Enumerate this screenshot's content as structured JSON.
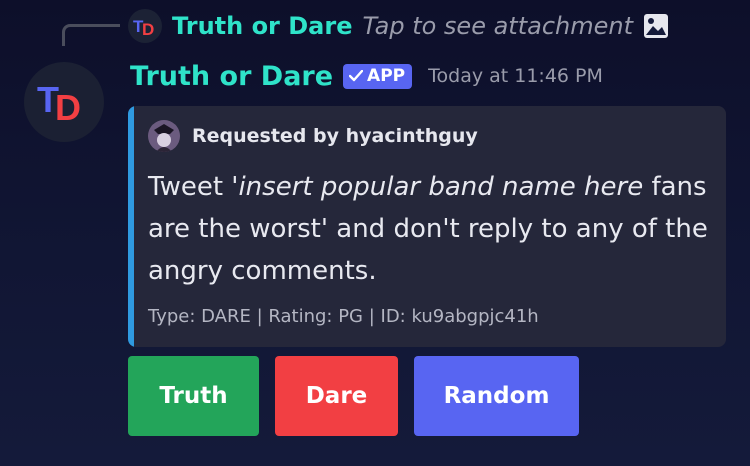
{
  "reply": {
    "author": "Truth or Dare",
    "preview": "Tap to see attachment",
    "attachment_icon": "image-icon"
  },
  "message": {
    "author": "Truth or Dare",
    "badge": "APP",
    "timestamp": "Today at 11:46 PM",
    "avatar_text": "TD"
  },
  "embed": {
    "author": "Requested by hyacinthguy",
    "desc_prefix": "Tweet '",
    "desc_italic": "insert popular band name here",
    "desc_suffix": " fans are the worst' and don't reply to any of the angry comments.",
    "footer": "Type: DARE | Rating: PG | ID: ku9abgpjc41h",
    "accent_color": "#2f9ae0"
  },
  "buttons": {
    "truth": "Truth",
    "dare": "Dare",
    "random": "Random"
  },
  "colors": {
    "author": "#2fe3c9",
    "truth": "#23a55a",
    "dare": "#f23f43",
    "random": "#5865f2"
  }
}
